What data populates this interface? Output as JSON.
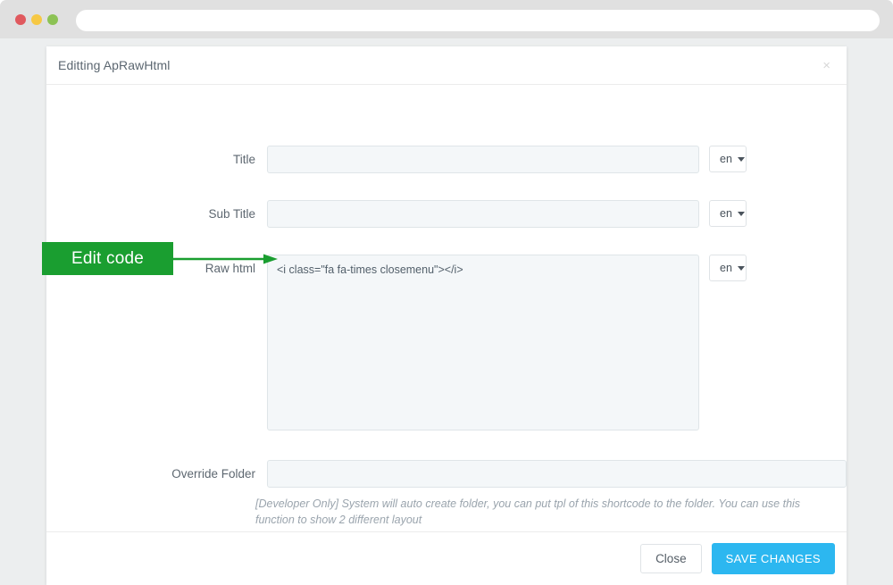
{
  "browser": {
    "traffic_lights": [
      {
        "name": "close",
        "color": "#e0595e"
      },
      {
        "name": "minimize",
        "color": "#f6c844"
      },
      {
        "name": "maximize",
        "color": "#8cc254"
      }
    ],
    "address_bar": {
      "value": "",
      "placeholder": ""
    }
  },
  "modal": {
    "title": "Editting ApRawHtml",
    "close_icon": "close-icon",
    "close_glyph": "×",
    "fields": {
      "title": {
        "label": "Title",
        "value": "",
        "placeholder": "",
        "lang": "en"
      },
      "subtitle": {
        "label": "Sub Title",
        "value": "",
        "placeholder": "",
        "lang": "en"
      },
      "rawhtml": {
        "label": "Raw html",
        "value": "<i class=\"fa fa-times closemenu\"></i>",
        "placeholder": "",
        "lang": "en"
      },
      "override_folder": {
        "label": "Override Folder",
        "value": "",
        "placeholder": "",
        "help": "[Developer Only] System will auto create folder, you can put tpl of this shortcode to the folder. You can use this function to show 2 different layout"
      }
    },
    "footer": {
      "close_label": "Close",
      "save_label": "SAVE CHANGES"
    }
  },
  "annotation": {
    "label": "Edit code",
    "color": "#1a9e30",
    "arrow_icon": "arrow-right-icon"
  },
  "colors": {
    "accent_blue": "#2cb7f0",
    "annotation_green": "#1a9e30",
    "field_fill": "#f4f7f9",
    "backdrop": "#eceeef",
    "chrome": "#e0e0e0"
  }
}
